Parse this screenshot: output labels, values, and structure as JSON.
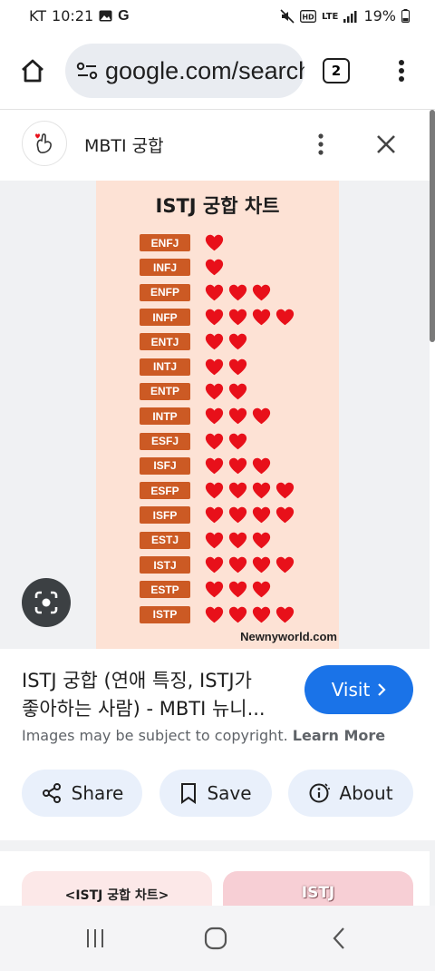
{
  "status_bar": {
    "carrier": "KT",
    "time": "10:21",
    "battery": "19%"
  },
  "browser": {
    "url": "google.com/search",
    "tab_count": "2"
  },
  "result_header": {
    "source_name": "MBTI 궁합"
  },
  "chart_image": {
    "title": "ISTJ 궁합 차트",
    "credit": "Newnyworld.com",
    "rows": [
      {
        "type": "ENFJ",
        "hearts": 1
      },
      {
        "type": "INFJ",
        "hearts": 1
      },
      {
        "type": "ENFP",
        "hearts": 3
      },
      {
        "type": "INFP",
        "hearts": 4
      },
      {
        "type": "ENTJ",
        "hearts": 2
      },
      {
        "type": "INTJ",
        "hearts": 2
      },
      {
        "type": "ENTP",
        "hearts": 2
      },
      {
        "type": "INTP",
        "hearts": 3
      },
      {
        "type": "ESFJ",
        "hearts": 2
      },
      {
        "type": "ISFJ",
        "hearts": 3
      },
      {
        "type": "ESFP",
        "hearts": 4
      },
      {
        "type": "ISFP",
        "hearts": 4
      },
      {
        "type": "ESTJ",
        "hearts": 3
      },
      {
        "type": "ISTJ",
        "hearts": 4
      },
      {
        "type": "ESTP",
        "hearts": 3
      },
      {
        "type": "ISTP",
        "hearts": 4
      }
    ]
  },
  "result": {
    "title_line1": "ISTJ 궁합 (연애 특징, ISTJ가",
    "title_line2": "좋아하는 사람) - MBTI 뉴니...",
    "visit_label": "Visit",
    "copyright": "Images may be subject to copyright.",
    "learn_more": "Learn More"
  },
  "actions": {
    "share": "Share",
    "save": "Save",
    "about": "About"
  },
  "related": {
    "thumb1_text": "<ISTJ 궁합 차트>",
    "thumb2_text": "ISTJ"
  },
  "colors": {
    "accent": "#1a73e8",
    "label_bg": "#cc5a24",
    "heart": "#e8101a",
    "chart_bg": "#fde2d5"
  }
}
